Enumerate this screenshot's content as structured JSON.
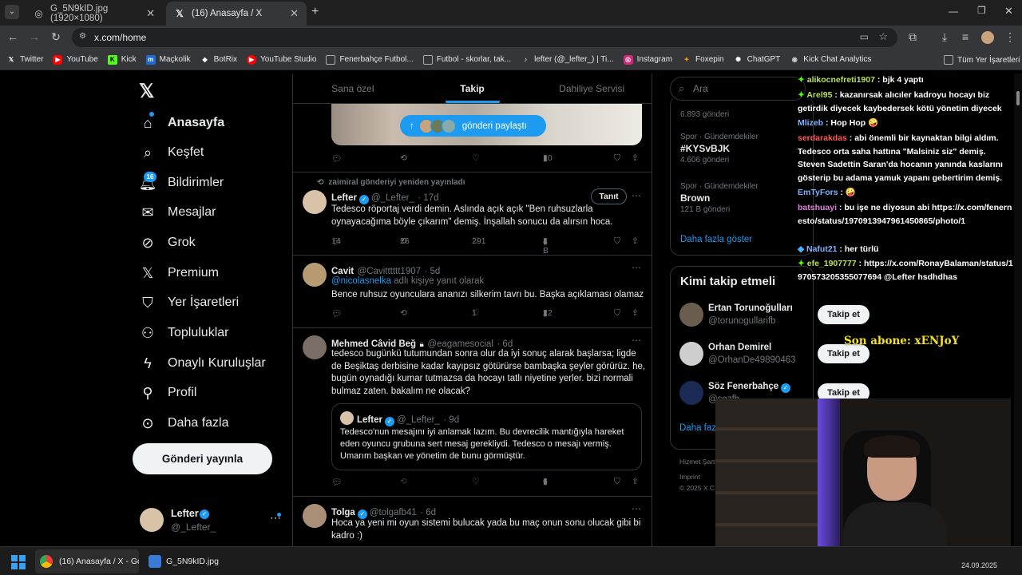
{
  "browser": {
    "tabs": [
      {
        "title": "G_5N9kID.jpg (1920×1080)"
      },
      {
        "title": "(16) Anasayfa / X"
      }
    ],
    "url": "x.com/home",
    "bookmarks": [
      "Twitter",
      "YouTube",
      "Kick",
      "Maçkolik",
      "BotRix",
      "YouTube Studio",
      "Fenerbahçe Futbol...",
      "Futbol - skorlar, tak...",
      "lefter (@_lefter_) | Ti...",
      "Instagram",
      "Foxepin",
      "ChatGPT",
      "Kick Chat Analytics"
    ],
    "all_bookmarks": "Tüm Yer İşaretleri"
  },
  "sidebar": {
    "items": [
      {
        "label": "Anasayfa",
        "icon": "home-icon"
      },
      {
        "label": "Keşfet",
        "icon": "search-icon"
      },
      {
        "label": "Bildirimler",
        "icon": "bell-icon",
        "badge": "16"
      },
      {
        "label": "Mesajlar",
        "icon": "mail-icon"
      },
      {
        "label": "Grok",
        "icon": "grok-icon"
      },
      {
        "label": "Premium",
        "icon": "x-logo-icon"
      },
      {
        "label": "Yer İşaretleri",
        "icon": "bookmark-icon"
      },
      {
        "label": "Topluluklar",
        "icon": "communities-icon"
      },
      {
        "label": "Onaylı Kuruluşlar",
        "icon": "lightning-icon"
      },
      {
        "label": "Profil",
        "icon": "person-icon"
      },
      {
        "label": "Daha fazla",
        "icon": "more-circle-icon"
      }
    ],
    "post_button": "Gönderi yayınla",
    "account": {
      "name": "Lefter",
      "handle": "@_Lefter_"
    }
  },
  "feed": {
    "tabs": [
      "Sana özel",
      "Takip",
      "Dahiliye Servisi"
    ],
    "share_pill": "gönderi paylaştı",
    "post0": {
      "views": "10"
    },
    "post1": {
      "repost_note": "zaimiral gönderiyi yeniden yayınladı",
      "name": "Lefter",
      "handle": "@_Lefter_",
      "time": "· 17d",
      "follow": "Tanıt",
      "text": "Tedesco röportaj verdi demin. Aslında açık açık \"Ben ruhsuzlarla oynayacağıma böyle çıkarım\" demiş. İnşallah sonucu da alırsın hoca.",
      "replies": "14",
      "reposts": "26",
      "likes": "291",
      "views": "4 B"
    },
    "post2": {
      "name": "Cavit",
      "handle": "@Cavitttttt1907",
      "time": "· 5d",
      "reply_to": "@nicolasnelka",
      "reply_suffix": " adlı kişiye yanıt olarak",
      "text": "Bence ruhsuz oyunculara ananızı silkerim tavrı bu. Başka açıklaması olamaz",
      "likes": "1",
      "views": "22"
    },
    "post3": {
      "name": "Mehmed Câvid Beğ",
      "handle": "@eagamesocial",
      "time": "· 6d",
      "text": "tedesco bugünkü tutumundan sonra olur da iyi sonuç alarak başlarsa; ligde de Beşiktaş derbisine kadar kayıpsız götürürse bambaşka şeyler görürüz. he, bugün oynadığı kumar tutmazsa da hocayı tatlı niyetine yerler. bizi normali bulmaz zaten. bakalım ne olacak?",
      "quote": {
        "name": "Lefter",
        "handle": "@_Lefter_",
        "time": "· 9d",
        "text": "Tedesco'nun mesajını iyi anlamak lazım. Bu devrecilik mantığıyla hareket eden oyuncu grubuna sert mesaj gerekliydi. Tedesco o mesajı vermiş. Umarım başkan ve yönetim de bunu görmüştür."
      },
      "views": "6"
    },
    "post4": {
      "name": "Tolga",
      "handle": "@tolgafb41",
      "time": "· 6d",
      "text": "Hoca ya yeni mi oyun sistemi bulucak yada bu maç onun sonu olucak gibi bi kadro :)"
    }
  },
  "right": {
    "search_placeholder": "Ara",
    "trends": [
      {
        "cat": "",
        "name": "",
        "count": "6.893 gönderi"
      },
      {
        "cat": "Spor · Gündemdekiler",
        "name": "#KYSvBJK",
        "count": "4.606 gönderi"
      },
      {
        "cat": "Spor · Gündemdekiler",
        "name": "Brown",
        "count": "121 B gönderi"
      }
    ],
    "show_more": "Daha fazla göster",
    "who_to_follow": "Kimi takip etmeli",
    "suggestions": [
      {
        "name": "Ertan Torunoğulları",
        "handle": "@torunogullarifb"
      },
      {
        "name": "Orhan Demirel",
        "handle": "@OrhanDe49890463"
      },
      {
        "name": "Söz Fenerbahçe",
        "handle": "@sozfb..."
      }
    ],
    "follow_label": "Takip et",
    "more_short": "Daha faz",
    "footer": [
      "Hizmet Şart",
      "Imprint",
      "© 2025 X C"
    ]
  },
  "chat": [
    {
      "user": "alikocnefreti1907",
      "color": "#b8e05a",
      "msg": " : bjk 4 yaptı"
    },
    {
      "user": "Arel95",
      "color": "#b8e05a",
      "msg": " : kazanırsak alıcıler kadroyu hocayı biz getirdik diyecek kaybedersek kötü yönetim diyecek"
    },
    {
      "user": "Mlizeb",
      "color": "#7fb2ff",
      "msg": " : Hop Hop 🤪"
    },
    {
      "user": "serdarakdas",
      "color": "#ff5a5a",
      "msg": " : abi önemli bir kaynaktan bilgi aldım. Tedesco orta saha hattına \"Malsiniz siz\" demiş. Steven Sadettin Saran'da hocanın yanında kaslarını gösterip bu adama yamuk yapanı gebertirim demiş."
    },
    {
      "user": "EmTyFors",
      "color": "#7fb2ff",
      "msg": " : 🤪 "
    },
    {
      "user": "batshuayi",
      "color": "#e07fe0",
      "msg": " : bu işe ne diyosun abi https://x.com/fenernesto/status/1970913947961450865/photo/1"
    },
    {
      "user": "Nafut21",
      "color": "#7fb2ff",
      "msg": " : her türlü"
    },
    {
      "user": "efe_1907777",
      "color": "#b8e05a",
      "msg": " : https://x.com/RonayBalaman/status/1970573205355077694 @Lefter hsdhdhas"
    }
  ],
  "overlay_text": "Son abone: xENJoY",
  "taskbar": {
    "items": [
      "(16) Anasayfa / X - Goog",
      "G_5N9kID.jpg"
    ],
    "date": "24.09.2025"
  },
  "colors": {
    "accent": "#1d9bf0",
    "border": "#2f3336",
    "muted": "#71767b"
  }
}
